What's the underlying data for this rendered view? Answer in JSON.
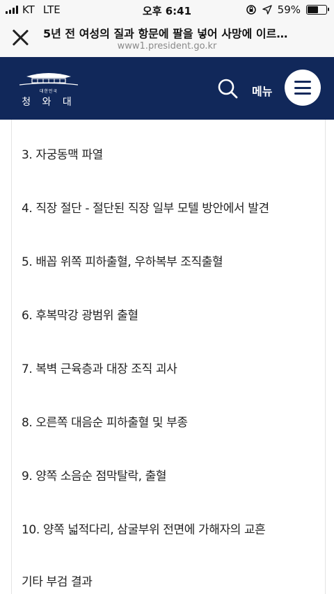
{
  "status_bar": {
    "carrier": "KT",
    "network": "LTE",
    "time": "오후 6:41",
    "battery": "59%",
    "battery_level": 0.59
  },
  "browser": {
    "page_title": "5년 전 여성의 질과 항문에 팔을 넣어 사망에 이르…",
    "url": "www1.president.go.kr",
    "close_icon": "close-icon"
  },
  "header": {
    "logo_subtext": "대한민국",
    "logo_text": "청 와 대",
    "menu_label": "메뉴",
    "search_icon": "search-icon",
    "menu_icon": "hamburger-icon",
    "background_color": "#11285a"
  },
  "content": {
    "items": [
      "3. 자궁동맥 파열",
      "4. 직장 절단 - 절단된 직장 일부 모텔 방안에서 발견",
      "5. 배꼽 위쪽 피하출혈, 우하복부 조직출혈",
      "6. 후복막강 광범위 출혈",
      "7. 복벽 근육층과 대장 조직 괴사",
      "8. 오른쪽 대음순 피하출혈 및 부종",
      "9. 양쪽 소음순 점막탈락, 출혈",
      "10. 양쪽 넓적다리, 삼굴부위 전면에 가해자의 교흔",
      "기타 부검 결과"
    ]
  }
}
